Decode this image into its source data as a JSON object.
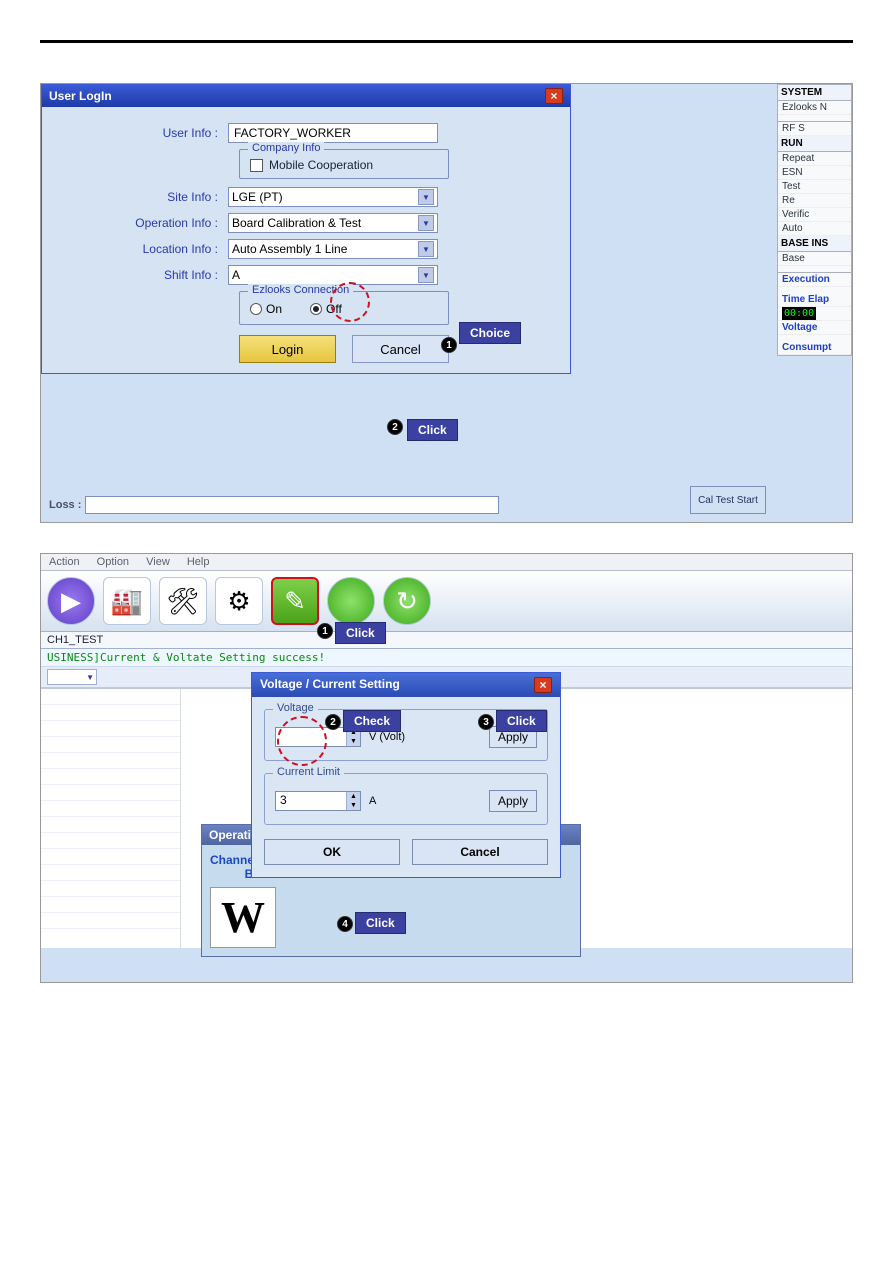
{
  "login": {
    "title": "User LogIn",
    "labels": {
      "user_info": "User Info :",
      "site_info": "Site Info :",
      "operation_info": "Operation Info :",
      "location_info": "Location Info :",
      "shift_info": "Shift Info :"
    },
    "user_value": "FACTORY_WORKER",
    "company_group": "Company Info",
    "company_check_label": "Mobile Cooperation",
    "site_value": "LGE (PT)",
    "operation_value": "Board Calibration & Test",
    "location_value": "Auto Assembly 1 Line",
    "shift_value": "A",
    "ezlooks_group": "Ezlooks Connection",
    "radio_on": "On",
    "radio_off": "Off",
    "login_btn": "Login",
    "cancel_btn": "Cancel",
    "loss_label": "Loss :",
    "cal_btn": "Cal Test Start"
  },
  "side": {
    "system": "SYSTEM",
    "ezlooks": "Ezlooks N",
    "rf": "RF S",
    "run": "RUN",
    "repeat": "Repeat",
    "esn": "ESN",
    "test": "Test",
    "re": "Re",
    "verific": "Verific",
    "auto": "Auto",
    "base_ins": "BASE INS",
    "base": "Base",
    "execution": "Execution",
    "time_elapsed": "Time Elap",
    "digits": "00:00",
    "voltage": "Voltage",
    "consumpt": "Consumpt"
  },
  "callouts": {
    "choice": "Choice",
    "click": "Click",
    "check": "Check",
    "1": "1",
    "2": "2",
    "3": "3",
    "4": "4"
  },
  "ss2": {
    "menu_action": "Action",
    "menu_option": "Option",
    "menu_view": "View",
    "menu_help": "Help",
    "tab": "CH1_TEST",
    "status_msg": "USINESS]Current & Voltate Setting success!",
    "op_title": "Operatio",
    "op_channel": "Channel",
    "op_bi": "Bll",
    "bigw": "W"
  },
  "vc": {
    "title": "Voltage / Current Setting",
    "voltage_leg": "Voltage",
    "v_unit": "V (Volt)",
    "v_value": "",
    "apply": "Apply",
    "current_leg": "Current Limit",
    "c_value": "3",
    "c_unit": "A",
    "ok": "OK",
    "cancel": "Cancel"
  }
}
